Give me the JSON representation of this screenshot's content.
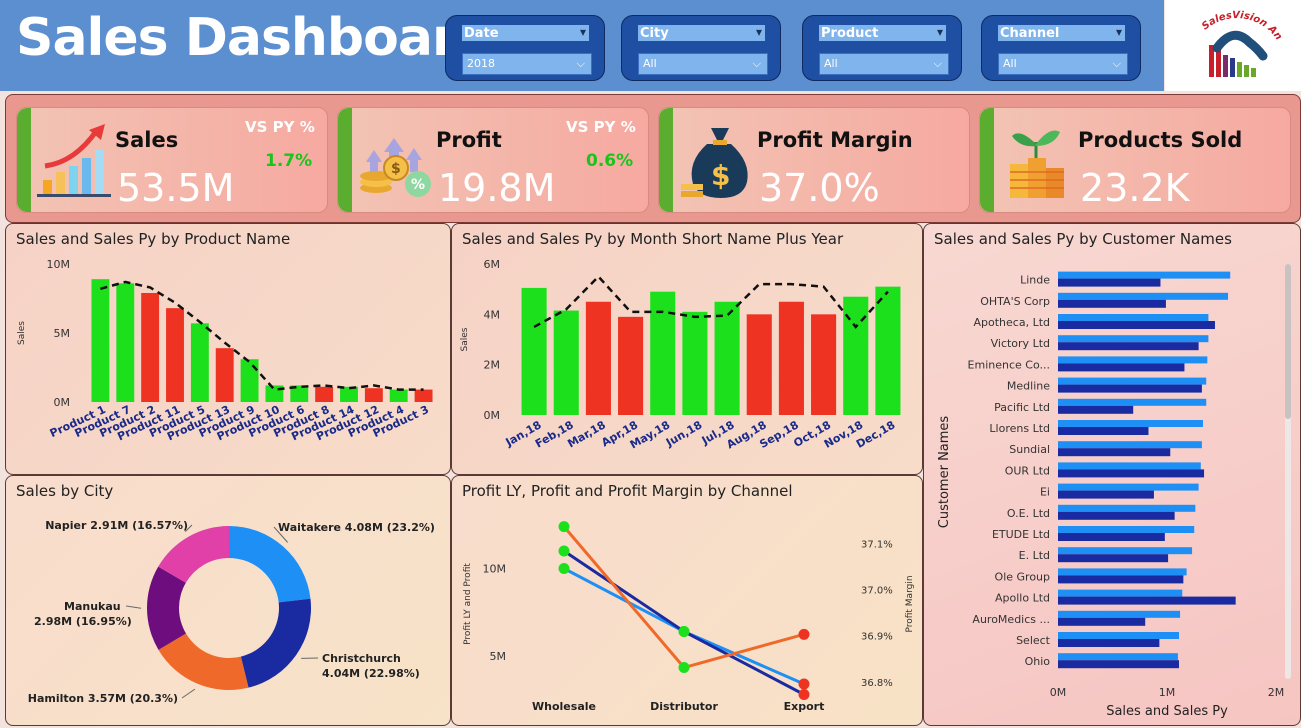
{
  "header": {
    "title": "Sales Dashboard",
    "slicers": [
      {
        "label": "Date",
        "value": "2018"
      },
      {
        "label": "City",
        "value": "All"
      },
      {
        "label": "Product",
        "value": "All"
      },
      {
        "label": "Channel",
        "value": "All"
      }
    ],
    "logo_text": "SalesVision Analytics"
  },
  "kpis": [
    {
      "name": "Sales",
      "value": "53.5M",
      "vs_label": "VS PY %",
      "vs_value": "1.7%",
      "icon": "sales-growth-icon"
    },
    {
      "name": "Profit",
      "value": "19.8M",
      "vs_label": "VS PY %",
      "vs_value": "0.6%",
      "icon": "profit-coins-icon"
    },
    {
      "name": "Profit Margin",
      "value": "37.0%",
      "icon": "money-bag-icon"
    },
    {
      "name": "Products Sold",
      "value": "23.2K",
      "icon": "plant-coins-icon"
    }
  ],
  "colors": {
    "green": "#1de01d",
    "red": "#ee3322",
    "blue_light": "#1e8ff5",
    "blue_dark": "#1a2aa0",
    "orange": "#ef6a2a"
  },
  "chart_data": [
    {
      "id": "product",
      "type": "bar",
      "title": "Sales and Sales Py by Product Name",
      "ylabel": "Sales",
      "ylim": [
        0,
        10
      ],
      "yticks": [
        "0M",
        "5M",
        "10M"
      ],
      "categories": [
        "Product 1",
        "Product 7",
        "Product 2",
        "Product 11",
        "Product 5",
        "Product 13",
        "Product 9",
        "Product 10",
        "Product 6",
        "Product 8",
        "Product 14",
        "Product 12",
        "Product 4",
        "Product 3"
      ],
      "series": [
        {
          "name": "Sales",
          "values": [
            8.9,
            8.6,
            7.9,
            6.8,
            5.7,
            3.9,
            3.1,
            1.2,
            1.2,
            1.1,
            1.1,
            1.0,
            0.9,
            0.9
          ]
        },
        {
          "name": "Sales Py",
          "values": [
            8.2,
            8.7,
            8.3,
            7.2,
            5.8,
            4.3,
            2.9,
            0.9,
            1.1,
            1.2,
            1.0,
            1.2,
            0.9,
            0.9
          ]
        }
      ],
      "bar_status": [
        "up",
        "up",
        "down",
        "down",
        "up",
        "down",
        "up",
        "up",
        "up",
        "down",
        "up",
        "down",
        "up",
        "down"
      ]
    },
    {
      "id": "month",
      "type": "bar",
      "title": "Sales and Sales Py by Month Short Name Plus Year",
      "ylabel": "Sales",
      "ylim": [
        0,
        6
      ],
      "yticks": [
        "0M",
        "2M",
        "4M",
        "6M"
      ],
      "categories": [
        "Jan,18",
        "Feb,18",
        "Mar,18",
        "Apr,18",
        "May,18",
        "Jun,18",
        "Jul,18",
        "Aug,18",
        "Sep,18",
        "Oct,18",
        "Nov,18",
        "Dec,18"
      ],
      "series": [
        {
          "name": "Sales",
          "values": [
            5.05,
            4.15,
            4.5,
            3.9,
            4.9,
            4.1,
            4.5,
            4.0,
            4.5,
            4.0,
            4.7,
            5.1
          ]
        },
        {
          "name": "Sales Py",
          "values": [
            3.5,
            4.2,
            5.5,
            4.1,
            4.1,
            3.9,
            3.95,
            5.2,
            5.2,
            5.1,
            3.5,
            4.9
          ]
        }
      ],
      "bar_status": [
        "up",
        "up",
        "down",
        "down",
        "up",
        "up",
        "up",
        "down",
        "down",
        "down",
        "up",
        "up"
      ]
    },
    {
      "id": "customer",
      "type": "bar",
      "orientation": "horizontal",
      "title": "Sales and Sales Py by Customer Names",
      "ylabel": "Customer Names",
      "xlabel": "Sales and Sales Py",
      "xlim": [
        0,
        2
      ],
      "xticks": [
        "0M",
        "1M",
        "2M"
      ],
      "categories": [
        "Linde",
        "OHTA'S Corp",
        "Apotheca, Ltd",
        "Victory Ltd",
        "Eminence Co...",
        "Medline",
        "Pacific Ltd",
        "Llorens Ltd",
        "Sundial",
        "OUR Ltd",
        "Ei",
        "O.E. Ltd",
        "ETUDE Ltd",
        "E. Ltd",
        "Ole Group",
        "Apollo Ltd",
        "AuroMedics ...",
        "Select",
        "Ohio"
      ],
      "series": [
        {
          "name": "Sales",
          "values": [
            1.58,
            1.56,
            1.38,
            1.38,
            1.37,
            1.36,
            1.36,
            1.33,
            1.32,
            1.31,
            1.29,
            1.26,
            1.25,
            1.23,
            1.18,
            1.14,
            1.12,
            1.11,
            1.1
          ]
        },
        {
          "name": "Sales Py",
          "values": [
            0.94,
            0.99,
            1.44,
            1.29,
            1.16,
            1.32,
            0.69,
            0.83,
            1.03,
            1.34,
            0.88,
            1.07,
            0.98,
            1.01,
            1.15,
            1.63,
            0.8,
            0.93,
            1.11
          ]
        }
      ]
    },
    {
      "id": "city",
      "type": "pie",
      "title": "Sales by City",
      "slices": [
        {
          "label": "Waitakere 4.08M (23.2%)",
          "value": 23.2,
          "color": "#1e8ff5"
        },
        {
          "label": "Christchurch 4.04M (22.98%)",
          "value": 22.98,
          "color": "#1a2aa0"
        },
        {
          "label": "Hamilton 3.57M (20.3%)",
          "value": 20.3,
          "color": "#ef6a2a"
        },
        {
          "label": "Manukau 2.98M (16.95%)",
          "value": 16.95,
          "color": "#6e0e7e"
        },
        {
          "label": "Napier 2.91M (16.57%)",
          "value": 16.57,
          "color": "#e040a8"
        }
      ]
    },
    {
      "id": "channel",
      "type": "line",
      "title": "Profit LY, Profit and Profit Margin by Channel",
      "ylabel": "Profit LY and Profit",
      "y2label": "Profit Margin",
      "categories": [
        "Wholesale",
        "Distributor",
        "Export"
      ],
      "ylim": [
        3.0,
        13.0
      ],
      "yticks": [
        "5M",
        "10M"
      ],
      "y2lim": [
        36.78,
        37.16
      ],
      "y2ticks": [
        "36.8%",
        "36.9%",
        "37.0%",
        "37.1%"
      ],
      "series": [
        {
          "name": "Profit LY",
          "axis": "left",
          "color": "#1e8ff5",
          "values": [
            10.0,
            6.4,
            3.4
          ]
        },
        {
          "name": "Profit",
          "axis": "left",
          "color": "#1a2aa0",
          "values": [
            11.0,
            6.4,
            2.8
          ]
        },
        {
          "name": "Profit Margin",
          "axis": "right",
          "color": "#ef6a2a",
          "values": [
            37.137,
            36.831,
            36.903
          ]
        }
      ]
    }
  ]
}
